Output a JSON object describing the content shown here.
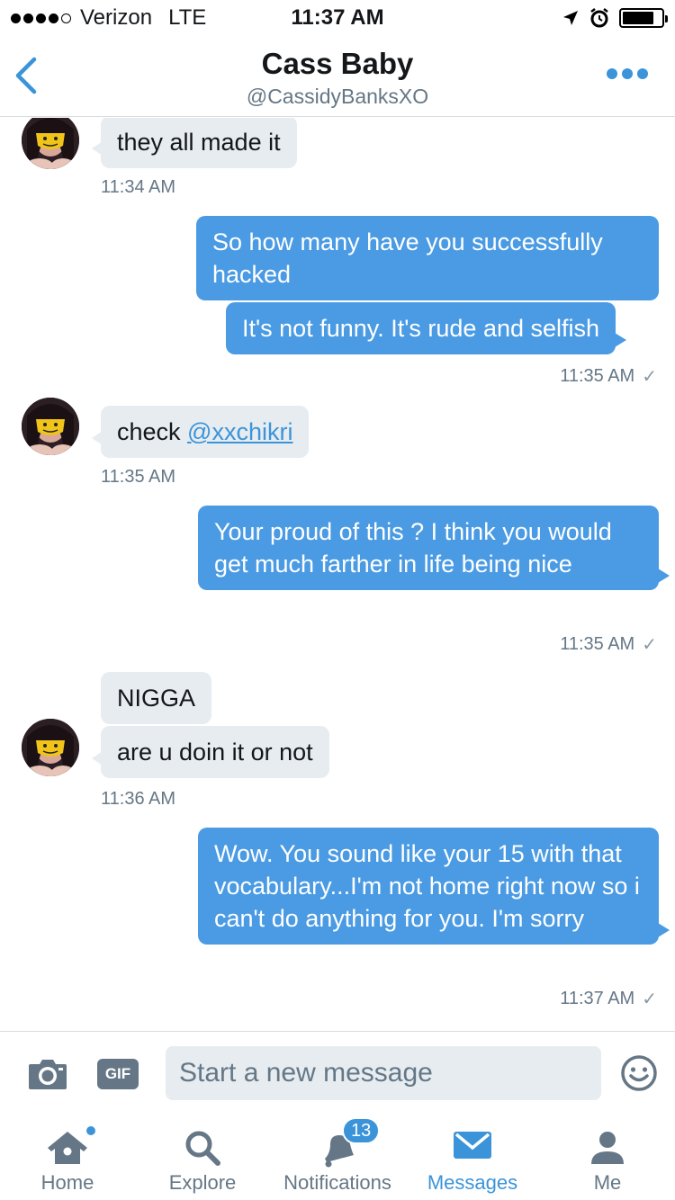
{
  "status_bar": {
    "carrier": "Verizon",
    "network": "LTE",
    "time": "11:37 AM",
    "signal_bars": 4,
    "battery_level": 0.8
  },
  "header": {
    "title": "Cass Baby",
    "handle": "@CassidyBanksXO",
    "back_icon": "chevron-left-icon",
    "more_icon": "more-dots-icon"
  },
  "messages": [
    {
      "from": "them",
      "text": "they all made it"
    },
    {
      "from": "them_time",
      "text": "11:34 AM"
    },
    {
      "from": "me",
      "text": "So how many have you successfully hacked"
    },
    {
      "from": "me",
      "text": "It's not funny. It's rude and selfish"
    },
    {
      "from": "me_time",
      "text": "11:35 AM"
    },
    {
      "from": "them",
      "prefix": "check ",
      "mention": "@xxchikri"
    },
    {
      "from": "them_time",
      "text": "11:35 AM"
    },
    {
      "from": "me",
      "text": "Your proud of this ? I think you would get much farther in life being nice"
    },
    {
      "from": "me_time",
      "text": "11:35 AM"
    },
    {
      "from": "them",
      "text": "NIGGA"
    },
    {
      "from": "them",
      "text": "are u doin it or not"
    },
    {
      "from": "them_time",
      "text": "11:36 AM"
    },
    {
      "from": "me",
      "text": "Wow. You sound like your 15 with that vocabulary...I'm not home right now so i can't do anything for you. I'm sorry"
    },
    {
      "from": "me_time",
      "text": "11:37 AM"
    }
  ],
  "composer": {
    "placeholder": "Start a new message",
    "gif_label": "GIF",
    "camera_icon": "camera-icon",
    "emoji_icon": "smiley-icon"
  },
  "tabs": [
    {
      "label": "Home",
      "icon": "home-icon",
      "has_dot": true
    },
    {
      "label": "Explore",
      "icon": "search-icon"
    },
    {
      "label": "Notifications",
      "icon": "bell-icon",
      "badge": "13"
    },
    {
      "label": "Messages",
      "icon": "envelope-icon",
      "active": true
    },
    {
      "label": "Me",
      "icon": "person-icon"
    }
  ],
  "colors": {
    "accent": "#3b94d9",
    "outgoing_bubble": "#4a9be3",
    "incoming_bubble": "#e6ecf0",
    "secondary_text": "#657786"
  }
}
